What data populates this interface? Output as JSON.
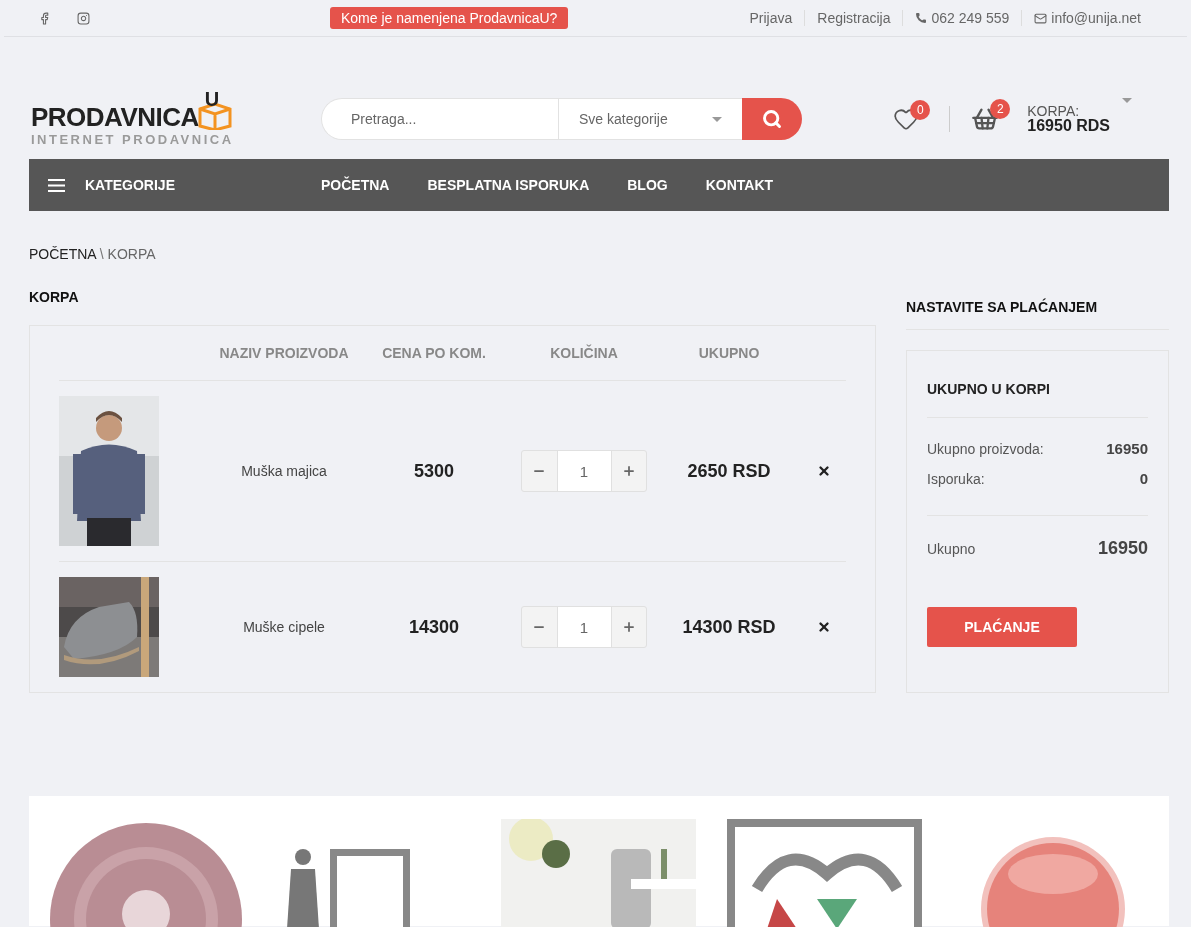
{
  "top_bar": {
    "promo": "Kome je namenjena ProdavnicaU?",
    "links": [
      "Prijava",
      "Registracija"
    ],
    "phone": "062 249 559",
    "email": "info@unija.net"
  },
  "header": {
    "logo": {
      "name": "PRODAVNICA",
      "badge": "U",
      "tagline": "INTERNET PRODAVNICA"
    },
    "search": {
      "placeholder": "Pretraga...",
      "category": "Sve kategorije"
    },
    "wishlist_count": "0",
    "cart_count": "2",
    "cart_label": "KORPA:",
    "cart_total": "16950 RDS"
  },
  "nav": {
    "categories": "KATEGORIJE",
    "items": [
      "POČETNA",
      "BESPLATNA ISPORUKA",
      "BLOG",
      "KONTAKT"
    ]
  },
  "breadcrumb": {
    "items": [
      "POČETNA",
      "KORPA"
    ],
    "separator": "\\"
  },
  "cart": {
    "title": "KORPA",
    "columns": [
      "NAZIV PROIZVODA",
      "CENA PO KOM.",
      "KOLIČINA",
      "UKUPNO"
    ],
    "rows": [
      {
        "image": {
          "kind": "person"
        },
        "name": "Muška majica",
        "price": "5300",
        "quantity": "1",
        "total": "2650 RSD"
      },
      {
        "image": {
          "kind": "shoe"
        },
        "name": "Muške cipele",
        "price": "14300",
        "quantity": "1",
        "total": "14300 RSD"
      }
    ]
  },
  "summary": {
    "heading": "NASTAVITE SA PLAĆANJEM",
    "title": "UKUPNO U KORPI",
    "lines": [
      {
        "label": "Ukupno proizvoda:",
        "value": "16950"
      },
      {
        "label": "Isporuka:",
        "value": "0"
      }
    ],
    "total": {
      "label": "Ukupno",
      "value": "16950"
    },
    "button": "PLAĆANJE"
  }
}
